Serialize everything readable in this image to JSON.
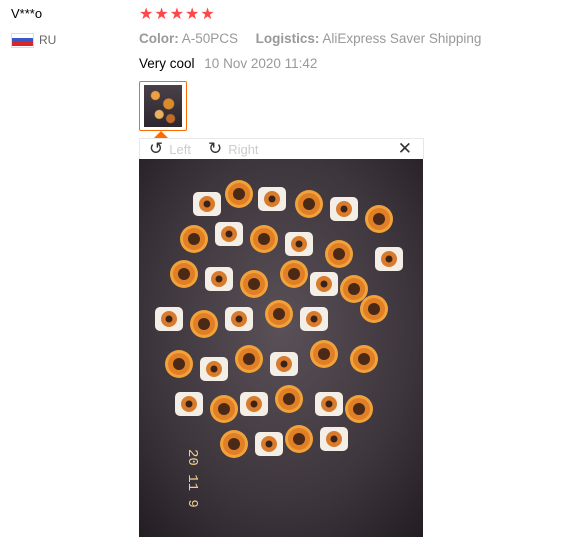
{
  "review": {
    "user": "V***o",
    "country": "RU",
    "rating": 5,
    "color_label": "Color:",
    "color_value": "A-50PCS",
    "logistics_label": "Logistics:",
    "logistics_value": "AliExpress Saver Shipping",
    "text": "Very cool",
    "date": "10 Nov 2020 11:42"
  },
  "viewer": {
    "rotate_left": "Left",
    "rotate_right": "Right",
    "photo_date_stamp": "20 11 9",
    "icons": {
      "rotate_left": "rotate-left-icon",
      "rotate_right": "rotate-right-icon",
      "close": "close-icon",
      "star": "star-icon"
    }
  },
  "colors": {
    "star": "#ff4747",
    "thumb_border": "#ff6a00",
    "muted": "#999999"
  }
}
